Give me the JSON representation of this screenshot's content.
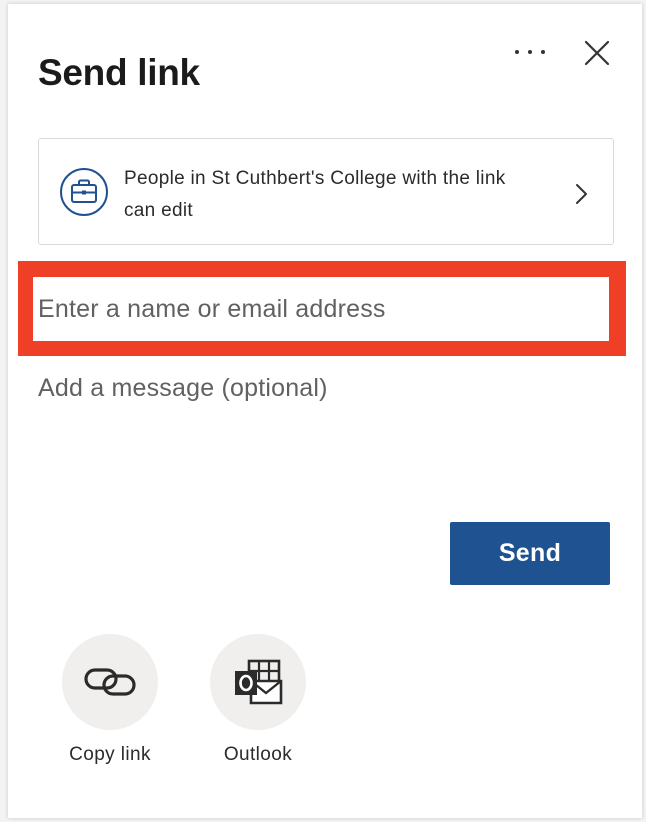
{
  "dialog": {
    "title": "Send link",
    "more_icon": "more-horizontal-icon",
    "close_icon": "close-icon"
  },
  "permission": {
    "icon": "briefcase-icon",
    "text": "People in St Cuthbert's College with the link can edit",
    "chevron_icon": "chevron-right-icon"
  },
  "recipient": {
    "placeholder": "Enter a name or email address",
    "value": "",
    "highlight_color": "#ef3f27"
  },
  "message": {
    "placeholder": "Add a message (optional)",
    "value": ""
  },
  "send_button": {
    "label": "Send",
    "color": "#1f5291"
  },
  "share_options": [
    {
      "label": "Copy link",
      "icon": "link-icon"
    },
    {
      "label": "Outlook",
      "icon": "outlook-icon"
    }
  ]
}
